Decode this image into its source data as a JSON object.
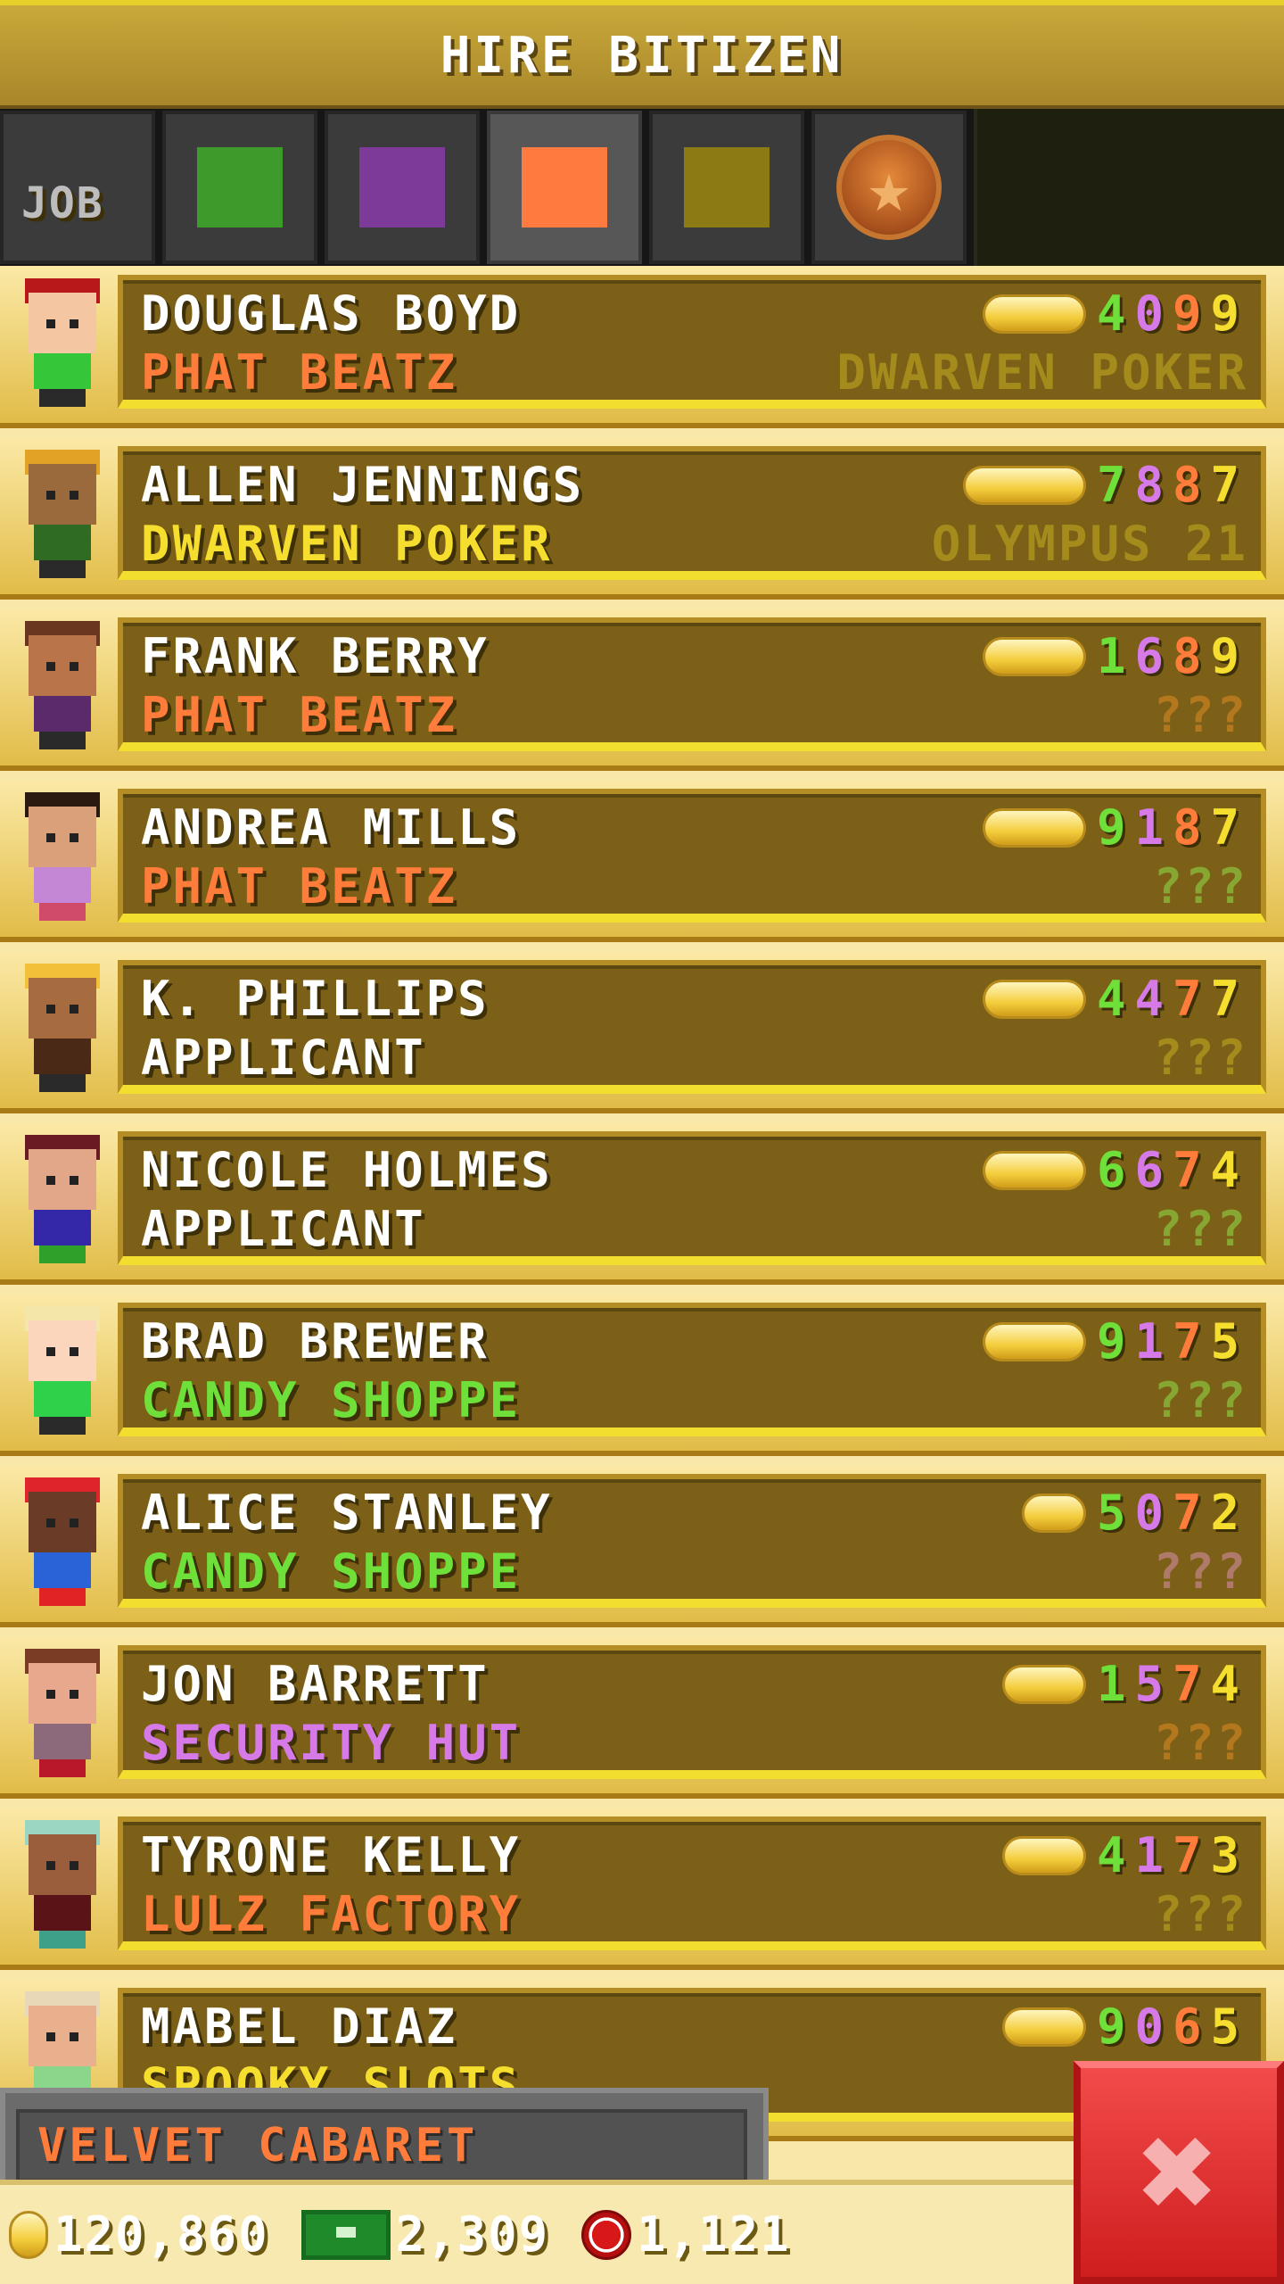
{
  "title": "HIRE BITIZEN",
  "tabs": [
    {
      "type": "text",
      "label": "JOB",
      "name": "tab-job"
    },
    {
      "type": "swatch",
      "color": "#3e9a2a",
      "name": "tab-green"
    },
    {
      "type": "swatch",
      "color": "#7e3a98",
      "name": "tab-purple"
    },
    {
      "type": "swatch",
      "color": "#ff7a3e",
      "name": "tab-orange",
      "active": true
    },
    {
      "type": "swatch",
      "color": "#8c7a14",
      "name": "tab-yellow"
    },
    {
      "type": "icon",
      "icon": "star-medal-icon",
      "name": "tab-star"
    }
  ],
  "colors": {
    "green": "#6fe03a",
    "purple": "#d67ae8",
    "orange": "#ff7c3a",
    "yellow": "#f5de2e",
    "white": "#ffffff",
    "dim": "#a48b1c"
  },
  "bitizens": [
    {
      "name": "DOUGLAS BOYD",
      "job": "PHAT BEATZ",
      "job_color": "orange",
      "dream": "DWARVEN POKER",
      "dream_color": "#a48b1c",
      "skills": [
        "4",
        "0",
        "9",
        "9"
      ],
      "coin": 3,
      "look": {
        "hair": "#b8181a",
        "skin": "#f5c6a2",
        "shirt": "#35c63a",
        "legs": "#2a2a2a"
      }
    },
    {
      "name": "ALLEN JENNINGS",
      "job": "DWARVEN POKER",
      "job_color": "yellow",
      "dream": "OLYMPUS 21",
      "dream_color": "#a48b1c",
      "skills": [
        "7",
        "8",
        "8",
        "7"
      ],
      "coin": 4,
      "look": {
        "hair": "#e1a226",
        "skin": "#9a6a3c",
        "shirt": "#2f6b23",
        "legs": "#2a2a2a"
      }
    },
    {
      "name": "FRANK BERRY",
      "job": "PHAT BEATZ",
      "job_color": "orange",
      "dream": "???",
      "dream_color": "#b3781e",
      "skills": [
        "1",
        "6",
        "8",
        "9"
      ],
      "coin": 3,
      "look": {
        "hair": "#6a3620",
        "skin": "#b9744a",
        "shirt": "#5a2a6a",
        "legs": "#2a2a2a"
      }
    },
    {
      "name": "ANDREA MILLS",
      "job": "PHAT BEATZ",
      "job_color": "orange",
      "dream": "???",
      "dream_color": "#87a632",
      "skills": [
        "9",
        "1",
        "8",
        "7"
      ],
      "coin": 3,
      "look": {
        "hair": "#2a1a10",
        "skin": "#d9a07a",
        "shirt": "#c387d6",
        "legs": "#d04a6a"
      }
    },
    {
      "name": "K. PHILLIPS",
      "job": "APPLICANT",
      "job_color": "white",
      "dream": "???",
      "dream_color": "#a48b1c",
      "skills": [
        "4",
        "4",
        "7",
        "7"
      ],
      "coin": 3,
      "look": {
        "hair": "#f3c03a",
        "skin": "#a66c40",
        "shirt": "#4a2a16",
        "legs": "#2a2a2a"
      }
    },
    {
      "name": "NICOLE HOLMES",
      "job": "APPLICANT",
      "job_color": "white",
      "dream": "???",
      "dream_color": "#87a632",
      "skills": [
        "6",
        "6",
        "7",
        "4"
      ],
      "coin": 3,
      "look": {
        "hair": "#6a1a22",
        "skin": "#e2a688",
        "shirt": "#3428a8",
        "legs": "#2fa02a"
      }
    },
    {
      "name": "BRAD BREWER",
      "job": "CANDY SHOPPE",
      "job_color": "green",
      "dream": "???",
      "dream_color": "#87a632",
      "skills": [
        "9",
        "1",
        "7",
        "5"
      ],
      "coin": 3,
      "look": {
        "hair": "#f4e6a8",
        "skin": "#fbd6bc",
        "shirt": "#2fd04a",
        "legs": "#2a2a2a"
      }
    },
    {
      "name": "ALICE STANLEY",
      "job": "CANDY SHOPPE",
      "job_color": "green",
      "dream": "???",
      "dream_color": "#b07a6a",
      "skills": [
        "5",
        "0",
        "7",
        "2"
      ],
      "coin": 1,
      "look": {
        "hair": "#e0242c",
        "skin": "#6a3c28",
        "shirt": "#2a62d8",
        "legs": "#e02424"
      }
    },
    {
      "name": "JON BARRETT",
      "job": "SECURITY HUT",
      "job_color": "purple",
      "dream": "???",
      "dream_color": "#b3781e",
      "skills": [
        "1",
        "5",
        "7",
        "4"
      ],
      "coin": 2,
      "look": {
        "hair": "#7a3c22",
        "skin": "#e8a88e",
        "shirt": "#8c6a7c",
        "legs": "#b8182a"
      }
    },
    {
      "name": "TYRONE KELLY",
      "job": "LULZ FACTORY",
      "job_color": "orange",
      "dream": "???",
      "dream_color": "#a48b1c",
      "skills": [
        "4",
        "1",
        "7",
        "3"
      ],
      "coin": 2,
      "look": {
        "hair": "#9ad6c2",
        "skin": "#9a5e3c",
        "shirt": "#5a1418",
        "legs": "#3fa08a"
      }
    },
    {
      "name": "MABEL DIAZ",
      "job": "SPOOKY SLOTS",
      "job_color": "yellow",
      "dream": "???",
      "dream_color": "#b07a6a",
      "skills": [
        "9",
        "0",
        "6",
        "5"
      ],
      "coin": 2,
      "look": {
        "hair": "#e8d8b8",
        "skin": "#e8b08c",
        "shirt": "#8ad68a",
        "legs": "#2a2a2a"
      }
    }
  ],
  "floor_label": "VELVET CABARET",
  "currency": {
    "coins": "120,860",
    "bux": "2,309",
    "chips": "1,121"
  },
  "close_label": "✖"
}
